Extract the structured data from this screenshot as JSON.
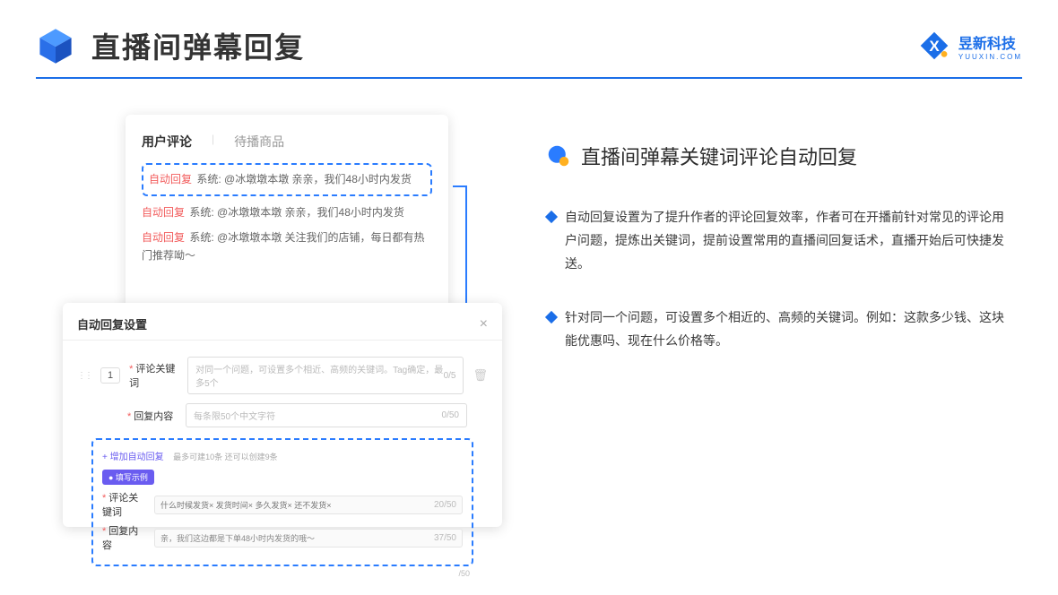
{
  "header": {
    "title": "直播间弹幕回复",
    "brand_cn": "昱新科技",
    "brand_en": "YUUXIN.COM"
  },
  "card_back": {
    "tab1": "用户评论",
    "tab2": "待播商品",
    "auto_tag": "自动回复",
    "c1": "系统: @冰墩墩本墩 亲亲，我们48小时内发货",
    "c2": "系统: @冰墩墩本墩 亲亲，我们48小时内发货",
    "c3": "系统: @冰墩墩本墩 关注我们的店铺，每日都有热门推荐呦～"
  },
  "card_front": {
    "title": "自动回复设置",
    "num": "1",
    "lbl_keyword": "评论关键词",
    "ph_keyword": "对同一个问题，可设置多个相近、高频的关键词。Tag确定，最多5个",
    "count_kw": "0/5",
    "lbl_reply": "回复内容",
    "ph_reply": "每条限50个中文字符",
    "count_reply": "0/50",
    "add_link": "+ 增加自动回复",
    "add_note": "最多可建10条 还可以创建9条",
    "ex_badge": "● 填写示例",
    "ex_kw_lbl": "评论关键词",
    "ex_tags": "什么时候发货× 发货时间× 多久发货× 还不发货×",
    "ex_kw_count": "20/50",
    "ex_reply_lbl": "回复内容",
    "ex_reply_val": "亲，我们这边都是下单48小时内发货的哦～",
    "ex_reply_count": "37/50",
    "side_count": "/50"
  },
  "right": {
    "title": "直播间弹幕关键词评论自动回复",
    "b1": "自动回复设置为了提升作者的评论回复效率，作者可在开播前针对常见的评论用户问题，提炼出关键词，提前设置常用的直播间回复话术，直播开始后可快捷发送。",
    "b2": "针对同一个问题，可设置多个相近的、高频的关键词。例如：这款多少钱、这块能优惠吗、现在什么价格等。"
  }
}
